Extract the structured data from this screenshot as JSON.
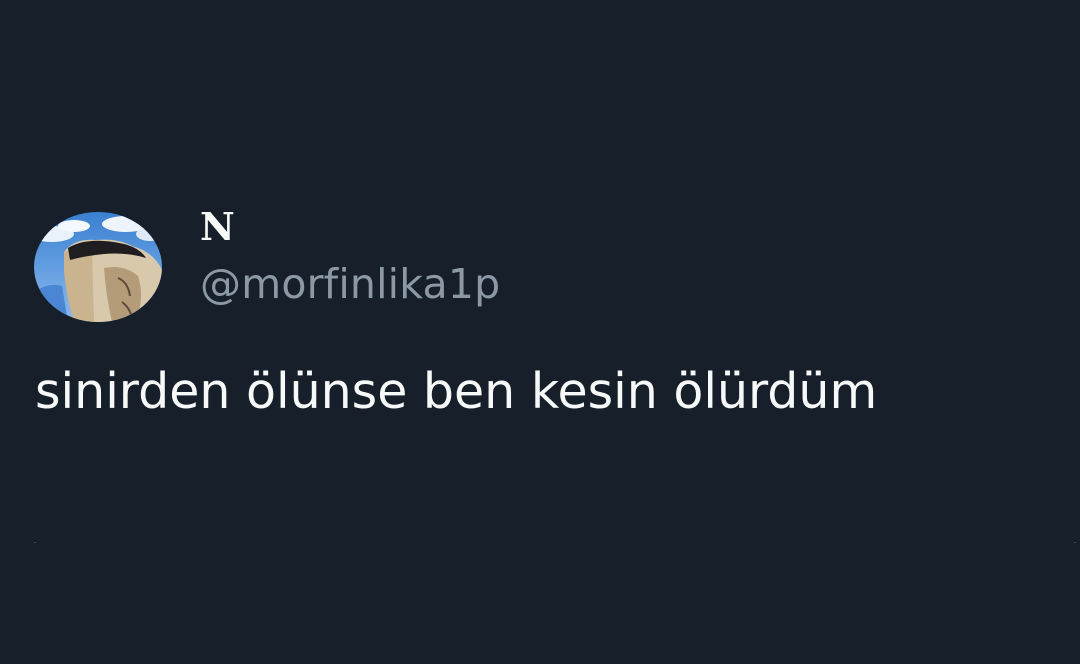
{
  "tweet": {
    "author": {
      "display_name": "N",
      "handle": "@morfinlika1p",
      "avatar_icon": "profile-photo"
    },
    "text": "sinirden ölünse ben kesin ölürdüm"
  },
  "colors": {
    "background": "#17202a",
    "primary_text": "#f7f9f9",
    "secondary_text": "#8b98a5"
  }
}
